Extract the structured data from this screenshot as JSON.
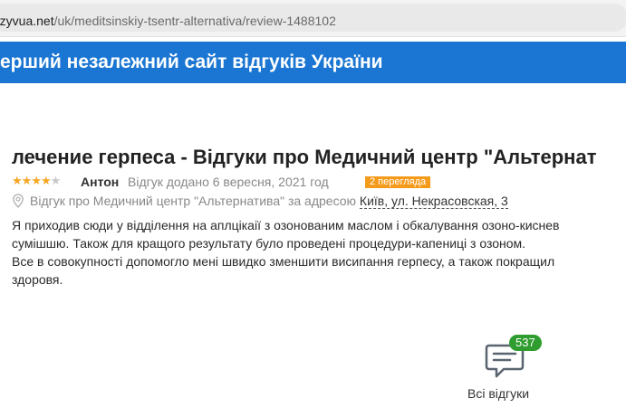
{
  "browser": {
    "url_host": "otzyvua.net",
    "url_path": "/uk/meditsinskiy-tsentr-alternativa/review-1488102"
  },
  "banner": {
    "text": "ерший незалежний сайт відгуків України",
    "color": "#1a76d2"
  },
  "review": {
    "title": "лечение герпеса - Відгуки про Медичний центр \"Альтернат",
    "rating": 4,
    "rating_max": 5,
    "author": "Антон",
    "added_text": "Відгук додано 6 вересня, 2021 год",
    "views_badge": "2 перегляда",
    "address_prefix": "Відгук про Медичний центр \"Альтернатива\" за адресою",
    "address_link": "Київ, ул. Некрасовская, 3",
    "body_lines": [
      "Я приходив сюди у відділення на аплцікаії з озонованим маслом і обкалування озоно-киснев",
      "сумішшю. Також для кращого результату було проведені процедури-капениці з озоном.",
      "Все в совокупності допомогло мені швидко зменшити висипання герпесу, а також покращил",
      "здоровя."
    ]
  },
  "all_reviews": {
    "label": "Всі відгуки",
    "count": "537",
    "icon": "chat-bubble-icon",
    "badge_color": "#2e9c2e"
  },
  "colors": {
    "star": "#f5a623",
    "views_badge": "#f59b1c"
  }
}
